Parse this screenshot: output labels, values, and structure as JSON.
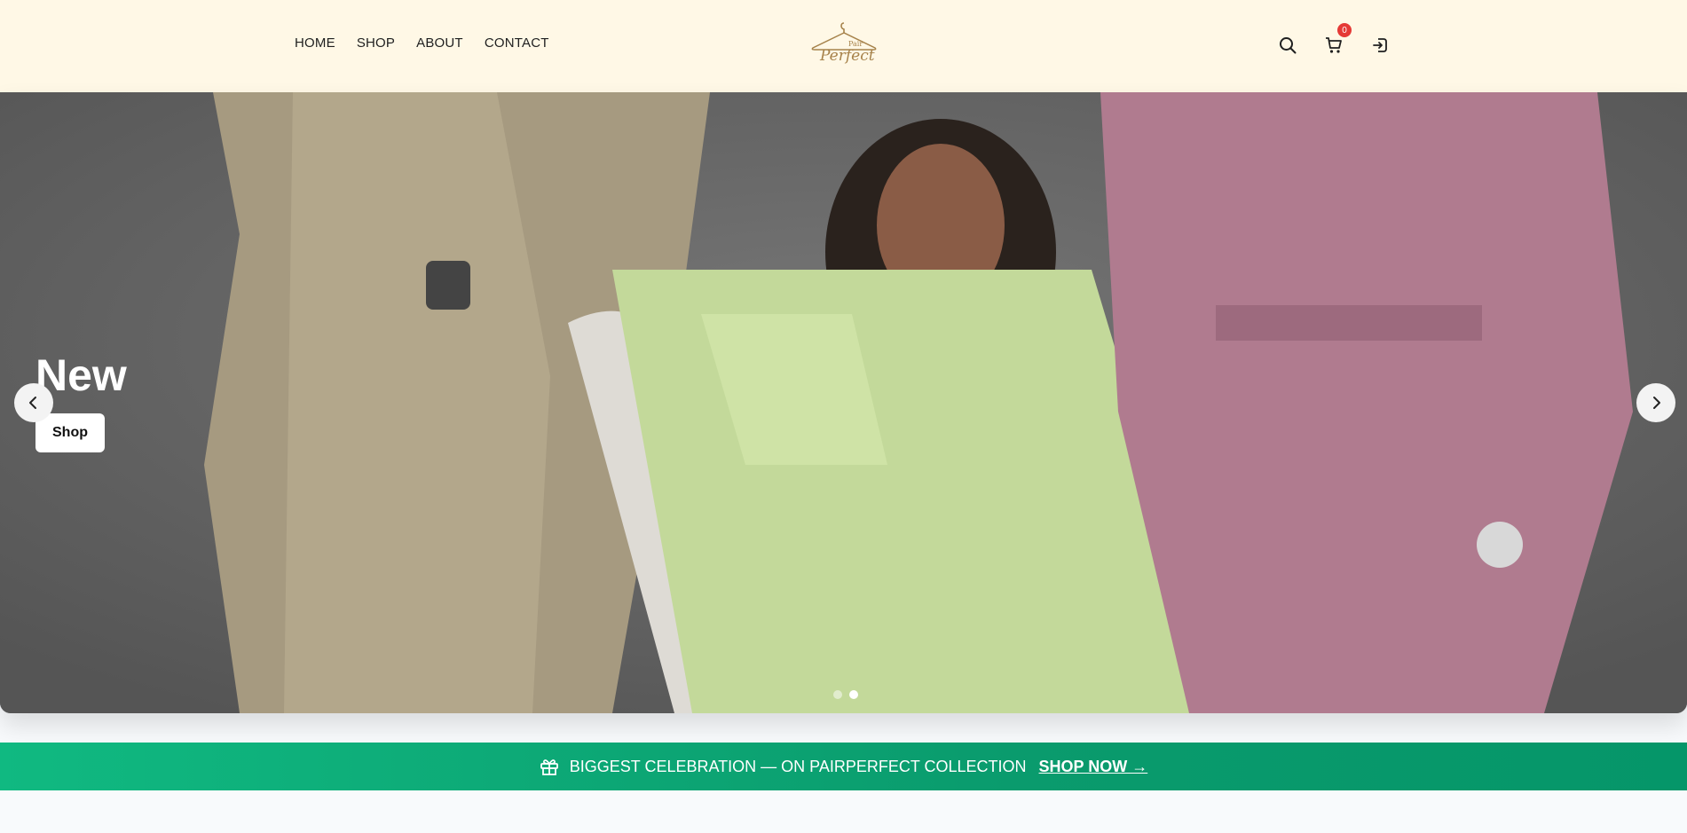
{
  "header": {
    "nav": [
      {
        "label": "HOME"
      },
      {
        "label": "SHOP"
      },
      {
        "label": "ABOUT"
      },
      {
        "label": "CONTACT"
      }
    ],
    "logo": {
      "line1": "Pair",
      "line2": "Perfect",
      "icon": "hanger-icon"
    },
    "icons": {
      "search": "search-icon",
      "cart": "cart-icon",
      "cart_count": "0",
      "login": "login-icon"
    }
  },
  "hero": {
    "title": "New",
    "button_label": "Shop",
    "slide_count": 2,
    "active_slide": 2,
    "prev_icon": "chevron-left-icon",
    "next_icon": "chevron-right-icon"
  },
  "promo": {
    "icon": "gift-icon",
    "text": "BIGGEST CELEBRATION — ON PAIRPERFECT COLLECTION",
    "link": "SHOP NOW →"
  },
  "colors": {
    "header_bg": "#fff8e6",
    "promo_green": "#10b981",
    "badge_red": "#e53935",
    "logo_gold": "#a6824a"
  }
}
